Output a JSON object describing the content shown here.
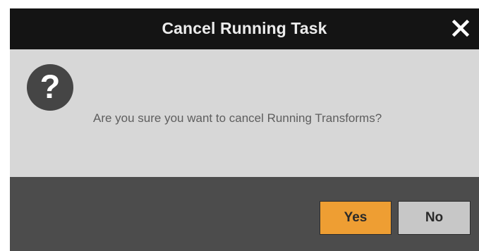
{
  "dialog": {
    "title": "Cancel Running Task",
    "message": "Are you sure you want to cancel Running Transforms?",
    "icon": "question-icon",
    "close_icon": "close-icon",
    "buttons": {
      "yes_label": "Yes",
      "no_label": "No"
    }
  },
  "colors": {
    "titlebar": "#141414",
    "body": "#d7d7d7",
    "footer": "#4c4c4c",
    "yes_button": "#ee9e33",
    "no_button": "#c7c7c7"
  }
}
